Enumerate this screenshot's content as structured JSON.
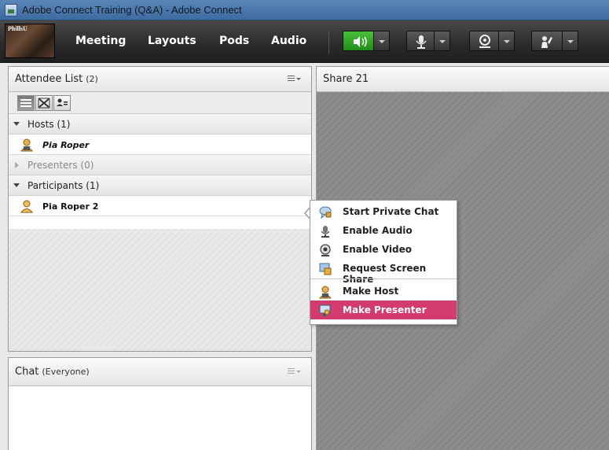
{
  "window": {
    "title": "Adobe Connect Training (Q&A) - Adobe Connect"
  },
  "logo": {
    "text": "PhillsU"
  },
  "menubar": {
    "items": [
      "Meeting",
      "Layouts",
      "Pods",
      "Audio"
    ]
  },
  "toolbar": {
    "buttons": [
      {
        "icon": "speaker-icon",
        "active": true
      },
      {
        "icon": "microphone-icon",
        "active": false
      },
      {
        "icon": "webcam-icon",
        "active": false
      },
      {
        "icon": "raise-hand-icon",
        "active": false
      }
    ],
    "active_color": "#2fa829"
  },
  "attendee_pod": {
    "title": "Attendee List",
    "count": "(2)",
    "sections": [
      {
        "label": "Hosts (1)",
        "expanded": true,
        "attendees": [
          {
            "name": "Pia Roper",
            "role_icon": "host-icon"
          }
        ]
      },
      {
        "label": "Presenters (0)",
        "expanded": false,
        "attendees": []
      },
      {
        "label": "Participants (1)",
        "expanded": true,
        "attendees": [
          {
            "name": "Pia Roper 2",
            "role_icon": "participant-icon"
          }
        ]
      }
    ]
  },
  "share_pod": {
    "title": "Share 21"
  },
  "chat_pod": {
    "title": "Chat",
    "scope": "(Everyone)"
  },
  "context_menu": {
    "items": [
      {
        "label": "Start Private Chat",
        "icon": "chat-bubble-icon"
      },
      {
        "label": "Enable Audio",
        "icon": "microphone-icon"
      },
      {
        "label": "Enable Video",
        "icon": "webcam-icon"
      },
      {
        "label": "Request Screen Share",
        "icon": "screen-share-icon"
      },
      {
        "label": "Make Host",
        "icon": "host-icon"
      },
      {
        "label": "Make Presenter",
        "icon": "presenter-icon",
        "selected": true
      }
    ],
    "highlight_color": "#d33a6e"
  }
}
